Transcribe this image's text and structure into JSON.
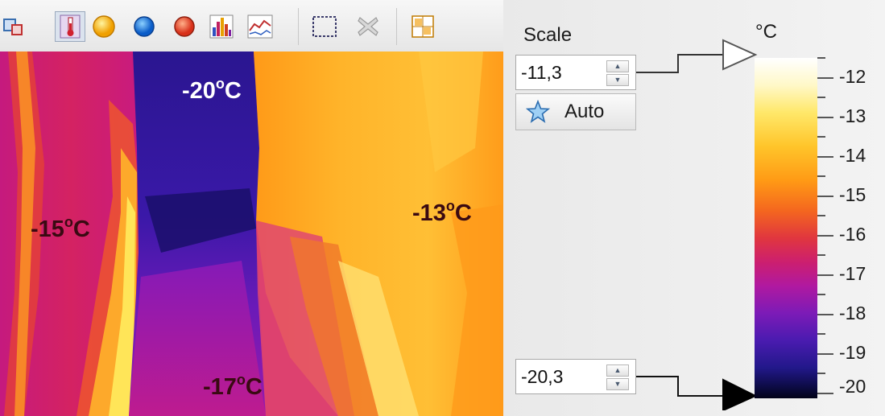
{
  "toolbar": {
    "buttons": [
      {
        "id": "layers",
        "icon": "layers-icon"
      },
      {
        "id": "thermometer",
        "icon": "thermometer-icon",
        "active": true
      },
      {
        "id": "hot-spot",
        "icon": "yellow-circle-icon"
      },
      {
        "id": "cold-spot",
        "icon": "blue-circle-icon"
      },
      {
        "id": "spot-red",
        "icon": "red-circle-icon"
      },
      {
        "id": "histogram",
        "icon": "histogram-icon"
      },
      {
        "id": "profile",
        "icon": "profile-chart-icon"
      },
      {
        "id": "select-area",
        "icon": "dashed-rectangle-icon"
      },
      {
        "id": "remove-area",
        "icon": "remove-shape-icon"
      },
      {
        "id": "grid",
        "icon": "grid-icon"
      }
    ]
  },
  "thermal_image": {
    "labels": {
      "top": "-20",
      "left": "-15",
      "right": "-13",
      "bottom": "-17",
      "degree_symbol": "o",
      "unit": "C"
    },
    "label_colors": {
      "top": "#ffffff",
      "left": "#3a0a12",
      "right": "#3a0a12",
      "bottom": "#3a0a12"
    }
  },
  "scale_panel": {
    "title": "Scale",
    "max_value": "-11,3",
    "min_value": "-20,3",
    "auto_label": "Auto",
    "unit": "°C",
    "ticks": [
      "-12",
      "-13",
      "-14",
      "-15",
      "-16",
      "-17",
      "-18",
      "-19",
      "-20"
    ],
    "palette": "iron",
    "colors": {
      "max_pointer": "#ffffff",
      "min_pointer": "#000000"
    }
  }
}
